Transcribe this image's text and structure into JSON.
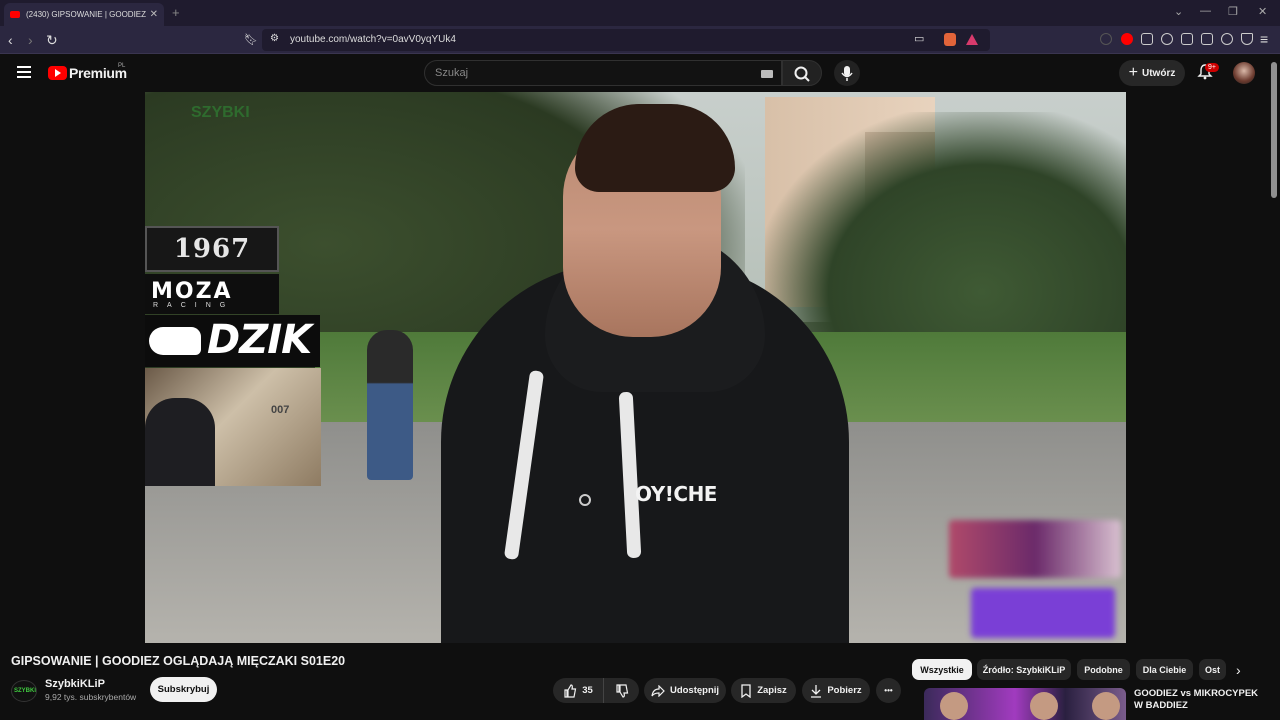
{
  "browser": {
    "tab_title": "(2430) GIPSOWANIE | GOODIEZ",
    "new_tab": "+",
    "url": "youtube.com/watch?v=0avV0yqYUk4"
  },
  "header": {
    "logo_text": "Premium",
    "country_code": "PL",
    "search_placeholder": "Szukaj",
    "create_label": "Utwórz",
    "notif_badge": "9+"
  },
  "video": {
    "overlay_watermark": "SZYBKI",
    "sponsor_1967": "1967",
    "sponsor_moza": "MOZA",
    "sponsor_moza_sub": "RACING",
    "sponsor_dzik": "DZIK",
    "hoodie_text": "OY!CHE",
    "room_sign": "007"
  },
  "info": {
    "title": "GIPSOWANIE | GOODIEZ OGLĄDAJĄ MIĘCZAKI S01E20",
    "channel_name": "SzybkiKLiP",
    "channel_avatar_text": "SZYBKI",
    "subscribers": "9,92 tys. subskrybentów",
    "subscribe_label": "Subskrybuj",
    "like_count": "35",
    "share_label": "Udostępnij",
    "save_label": "Zapisz",
    "download_label": "Pobierz",
    "more_label": "•••"
  },
  "chips": [
    "Wszystkie",
    "Źródło: SzybkiKLiP",
    "Podobne",
    "Dla Ciebie",
    "Ost"
  ],
  "related": {
    "title": "GOODIEZ vs MIKROCYPEK W BADDIEZ"
  }
}
